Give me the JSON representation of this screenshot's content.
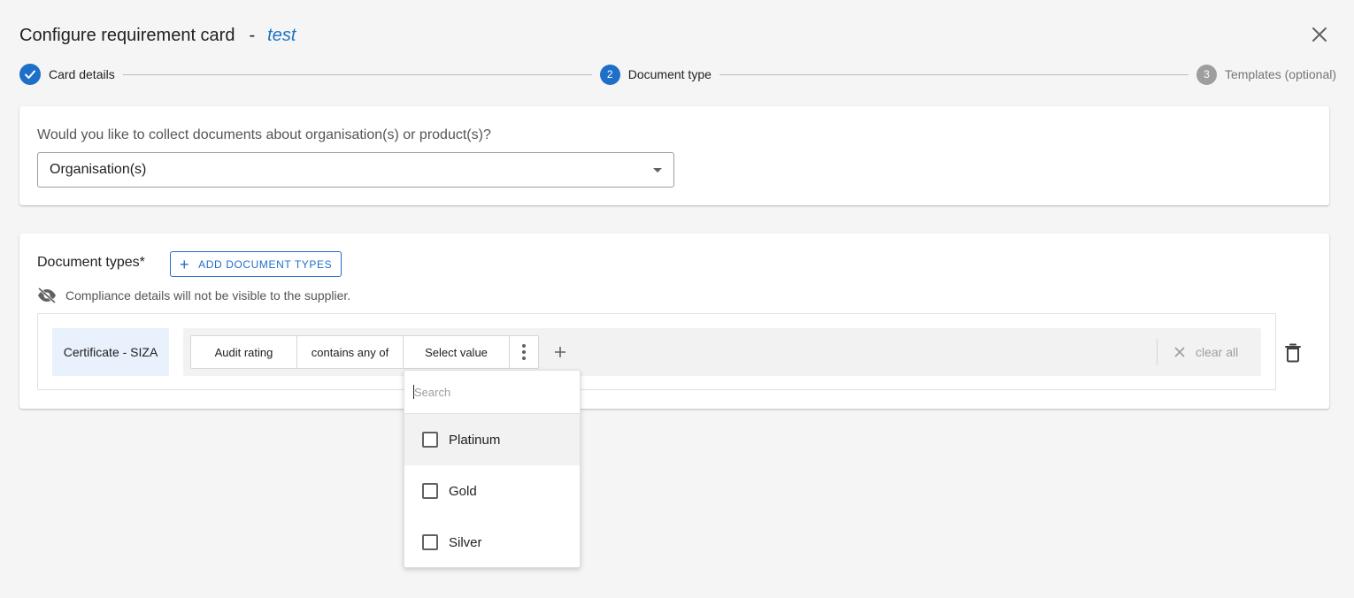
{
  "header": {
    "title": "Configure requirement card",
    "separator": "-",
    "card_name": "test"
  },
  "stepper": {
    "steps": [
      {
        "number": "1",
        "label": "Card details",
        "state": "completed"
      },
      {
        "number": "2",
        "label": "Document type",
        "state": "active"
      },
      {
        "number": "3",
        "label": "Templates (optional)",
        "state": "pending"
      }
    ]
  },
  "collect": {
    "question": "Would you like to collect documents about organisation(s) or product(s)?",
    "selected": "Organisation(s)"
  },
  "document_types": {
    "title": "Document types*",
    "add_button": "ADD DOCUMENT TYPES",
    "notice": "Compliance details will not be visible to the supplier.",
    "rule": {
      "document": "Certificate - SIZA",
      "field": "Audit rating",
      "operator": "contains any of",
      "value": "Select value",
      "clear_all": "clear all"
    }
  },
  "dropdown": {
    "search_placeholder": "Search",
    "options": [
      "Platinum",
      "Gold",
      "Silver"
    ]
  },
  "colors": {
    "accent": "#1e6fc8",
    "link": "#1a73c4",
    "chip_bg": "#e8f1fc",
    "pending_step": "#9e9e9e"
  }
}
